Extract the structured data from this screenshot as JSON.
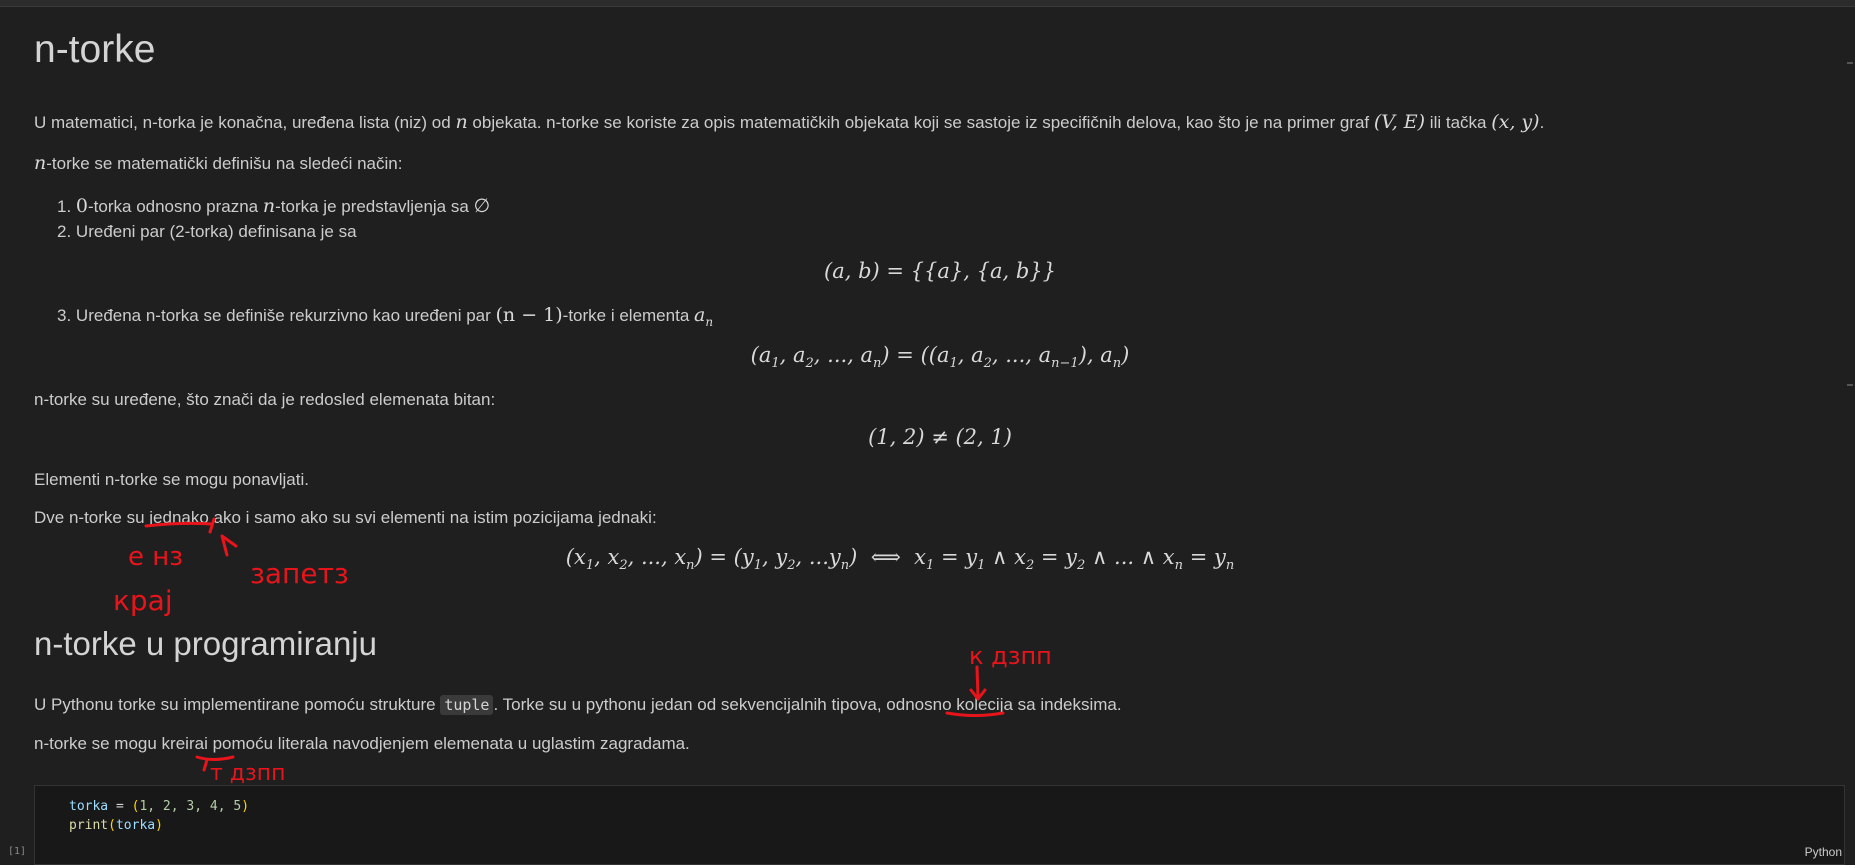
{
  "heading1": "n-torke",
  "intro": {
    "part1": "U matematici, n-torka je konačna, uređena lista (niz) od",
    "n": "n",
    "part2": "objekata. n-torke se koriste za opis matematičkih objekata koji se sastoje iz specifičnih delova, kao što je na primer graf",
    "graf": "(V, E)",
    "part3": "ili tačka",
    "tacka": "(x, y)",
    "end": "."
  },
  "def_line": {
    "n": "n",
    "text": "-torke se matematički definišu na sledeći način:"
  },
  "list": {
    "item1": {
      "num": "1.",
      "zero": "0",
      "a": "-torka odnosno prazna",
      "n": "n",
      "b": "-torka je predstavljenja sa",
      "empty": "∅"
    },
    "item2": {
      "num": "2.",
      "text": "Uređeni par (2-torka) definisana je sa"
    },
    "item3": {
      "num": "3.",
      "a": "Uređena n-torka se definiše rekurzivno kao uređeni par",
      "nm1": "(n − 1)",
      "b": "-torke i elementa",
      "an": "a"
    }
  },
  "eq_pair": "(a, b) = {{a}, {a, b}}",
  "eq_rec": {
    "lhs": "(a",
    "rhs": "((a"
  },
  "ordered_text": "n-torke su uređene, što znači da je redosled elemenata bitan:",
  "eq_neq": "(1, 2) ≠ (2, 1)",
  "repeat_text": "Elementi n-torke se mogu ponavljati.",
  "equal_text": "Dve n-torke su jednako ako i samo ako su svi elementi na istim pozicijama jednaki:",
  "heading2": "n-torke u programiranju",
  "python_text": {
    "a": "U Pythonu torke su implementirane pomoću strukture",
    "code": "tuple",
    "b": ". Torke su u pythonu jedan od sekvencijalnih tipova, odnosno kolecija sa indeksima."
  },
  "create_text": "n-torke se mogu kreirai pomoću literala navodjenjem elemenata u uglastim zagradama.",
  "code": {
    "line1": {
      "var": "torka",
      "eq": " = ",
      "open": "(",
      "nums": "1, 2, 3, 4, 5",
      "close": ")"
    },
    "line2": {
      "fn": "print",
      "open": "(",
      "arg": "torka",
      "close": ")"
    }
  },
  "exec_count": "[1]",
  "language": "Python",
  "annotations": {
    "color": "#e8141b",
    "words": [
      "е нз",
      "крај",
      "запетз",
      "к дзпп",
      "т дзпп"
    ]
  }
}
